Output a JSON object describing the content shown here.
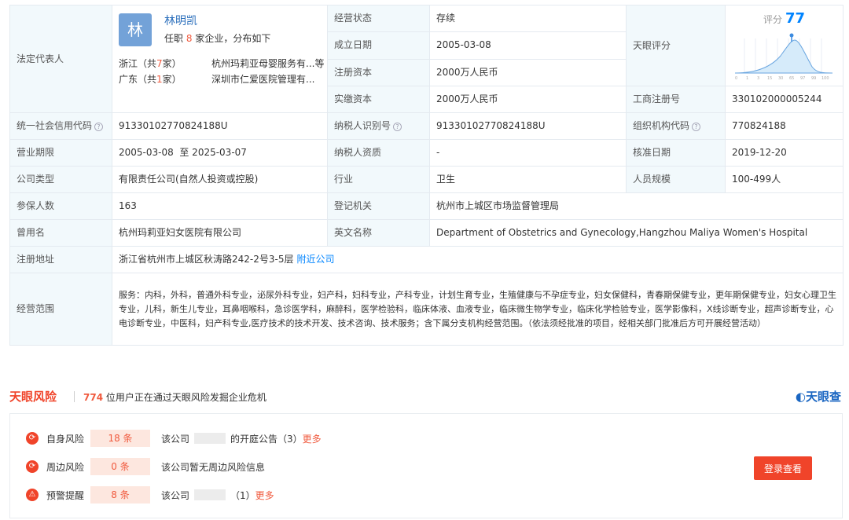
{
  "rep": {
    "label": "法定代表人",
    "avatar_char": "林",
    "name": "林明凯",
    "sub_pre": "任职",
    "sub_num": "8",
    "sub_post": "家企业，分布如下",
    "rows": [
      {
        "prov": "浙江（共",
        "num": "7",
        "prov_end": "家）",
        "company": "杭州玛莉亚母婴服务有...等"
      },
      {
        "prov": "广东（共",
        "num": "1",
        "prov_end": "家）",
        "company": "深圳市仁爱医院管理有..."
      }
    ]
  },
  "status": {
    "label": "经营状态",
    "value": "存续"
  },
  "found": {
    "label": "成立日期",
    "value": "2005-03-08"
  },
  "reg_cap": {
    "label": "注册资本",
    "value": "2000万人民币"
  },
  "paid_cap": {
    "label": "实缴资本",
    "value": "2000万人民币"
  },
  "tianyan": {
    "label": "天眼评分",
    "score_label": "评分",
    "score": "77",
    "ticks": [
      "0",
      "1",
      "3",
      "15",
      "30",
      "65",
      "97",
      "99",
      "100"
    ]
  },
  "biz_reg": {
    "label": "工商注册号",
    "value": "330102000005244"
  },
  "credit": {
    "label": "统一社会信用代码",
    "value": "91330102770824188U"
  },
  "taxid": {
    "label": "纳税人识别号",
    "value": "91330102770824188U"
  },
  "orgcode": {
    "label": "组织机构代码",
    "value": "770824188"
  },
  "term": {
    "label": "营业期限",
    "value": "2005-03-08  至 2025-03-07"
  },
  "taxq": {
    "label": "纳税人资质",
    "value": "-"
  },
  "approve": {
    "label": "核准日期",
    "value": "2019-12-20"
  },
  "ctype": {
    "label": "公司类型",
    "value": "有限责任公司(自然人投资或控股)"
  },
  "industry": {
    "label": "行业",
    "value": "卫生"
  },
  "staff": {
    "label": "人员规模",
    "value": "100-499人"
  },
  "insured": {
    "label": "参保人数",
    "value": "163"
  },
  "authority": {
    "label": "登记机关",
    "value": "杭州市上城区市场监督管理局"
  },
  "formername": {
    "label": "曾用名",
    "value": "杭州玛莉亚妇女医院有限公司"
  },
  "engname": {
    "label": "英文名称",
    "value": "Department of Obstetrics and Gynecology,Hangzhou Maliya Women's Hospital"
  },
  "address": {
    "label": "注册地址",
    "value": "浙江省杭州市上城区秋涛路242-2号3-5层",
    "link": "附近公司"
  },
  "scope": {
    "label": "经营范围",
    "value": "服务：内科，外科，普通外科专业，泌尿外科专业，妇产科，妇科专业，产科专业，计划生育专业，生殖健康与不孕症专业，妇女保健科，青春期保健专业，更年期保健专业，妇女心理卫生专业，儿科，新生儿专业，耳鼻咽喉科，急诊医学科，麻醉科，医学检验科，临床体液、血液专业，临床微生物学专业，临床化学检验专业，医学影像科，X线诊断专业，超声诊断专业，心电诊断专业，中医科，妇产科专业,医疗技术的技术开发、技术咨询、技术服务；含下属分支机构经营范围。（依法须经批准的项目，经相关部门批准后方可开展经营活动）"
  },
  "risk": {
    "logo": "天眼风险",
    "count": "774",
    "count_text": "位用户正在通过天眼风险发掘企业危机",
    "brand": "天眼查",
    "login": "登录查看",
    "rows": [
      {
        "label": "自身风险",
        "badge": "18 条",
        "pre": "该公司",
        "post": "的开庭公告（3）",
        "more": "更多"
      },
      {
        "label": "周边风险",
        "badge": "0 条",
        "pre": "该公司暂无周边风险信息",
        "post": "",
        "more": ""
      },
      {
        "label": "预警提醒",
        "badge": "8 条",
        "pre": "该公司",
        "post": "（1）",
        "more": "更多"
      }
    ]
  },
  "colors": {
    "accent": "#0084ff",
    "danger": "#f0442a",
    "label_bg": "#f2f9fc"
  }
}
